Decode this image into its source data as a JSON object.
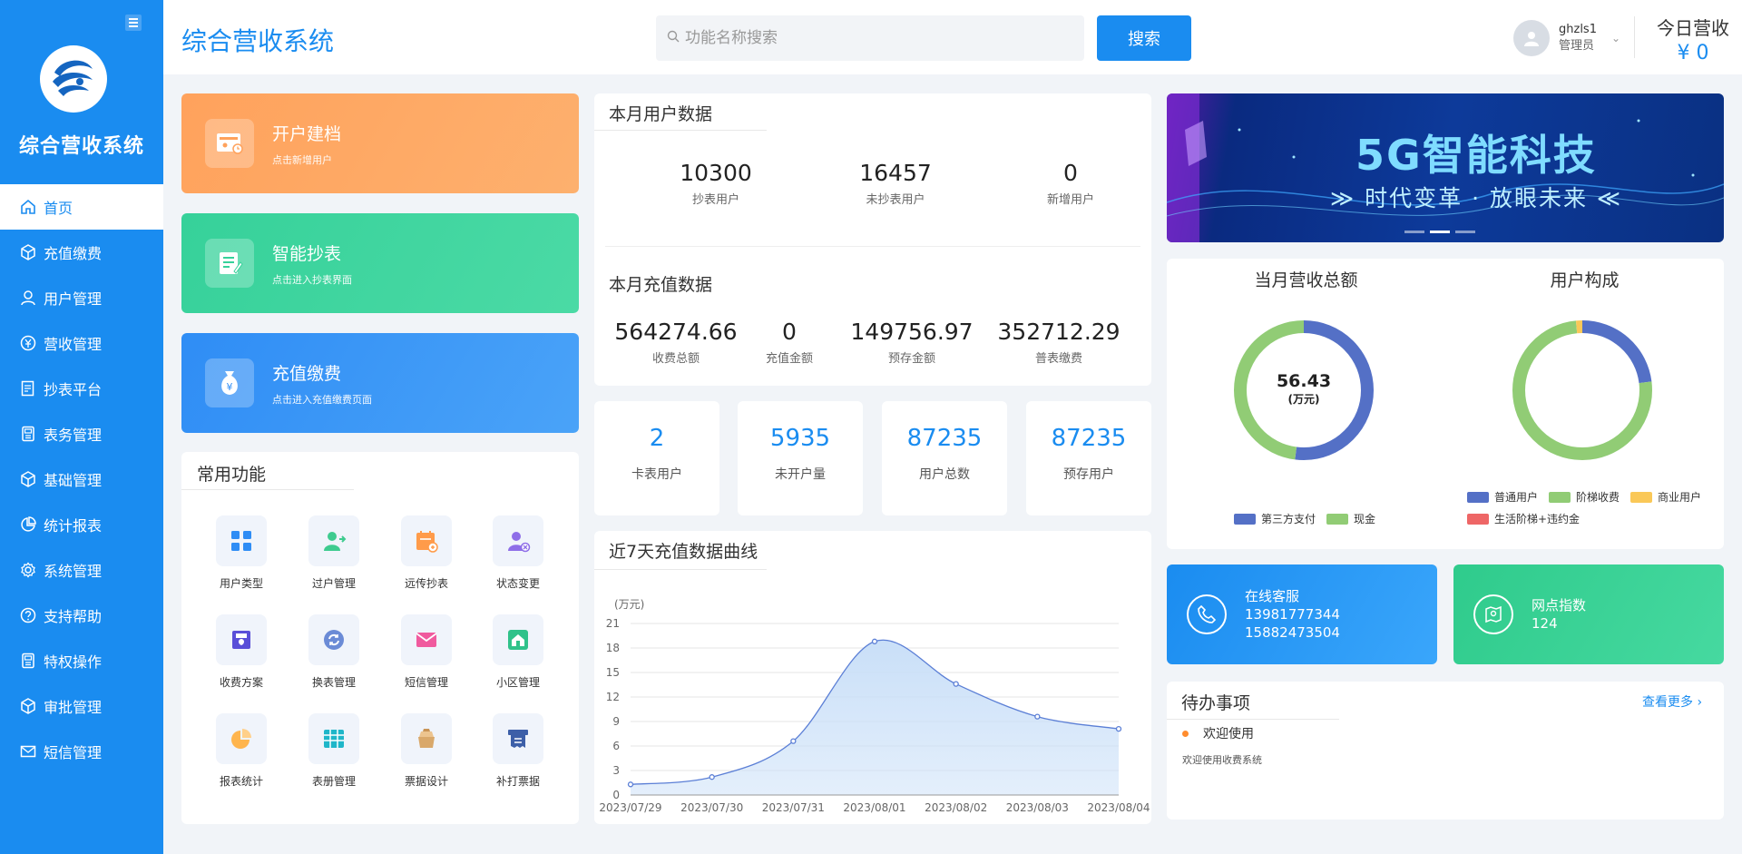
{
  "sidebar": {
    "title": "综合营收系统",
    "items": [
      {
        "label": "首页",
        "icon": "home-icon"
      },
      {
        "label": "充值缴费",
        "icon": "cube-icon"
      },
      {
        "label": "用户管理",
        "icon": "user-icon"
      },
      {
        "label": "营收管理",
        "icon": "yuan-icon"
      },
      {
        "label": "抄表平台",
        "icon": "doc-icon"
      },
      {
        "label": "表务管理",
        "icon": "meter-icon"
      },
      {
        "label": "基础管理",
        "icon": "cube-icon"
      },
      {
        "label": "统计报表",
        "icon": "pie-icon"
      },
      {
        "label": "系统管理",
        "icon": "gear-icon"
      },
      {
        "label": "支持帮助",
        "icon": "help-icon"
      },
      {
        "label": "特权操作",
        "icon": "meter-icon"
      },
      {
        "label": "审批管理",
        "icon": "cube-icon"
      },
      {
        "label": "短信管理",
        "icon": "mail-icon"
      }
    ]
  },
  "header": {
    "title": "综合营收系统",
    "search_placeholder": "功能名称搜索",
    "search_button": "搜索",
    "username": "ghzls1",
    "role": "管理员",
    "today_label": "今日营收",
    "today_value": "¥ 0"
  },
  "actions": [
    {
      "title": "开户建档",
      "sub": "点击新增用户",
      "color_from": "#ffa25c",
      "color_to": "#fdb06e"
    },
    {
      "title": "智能抄表",
      "sub": "点击进入抄表界面",
      "color_from": "#36d19a",
      "color_to": "#4bdaa5"
    },
    {
      "title": "充值缴费",
      "sub": "点击进入充值缴费页面",
      "color_from": "#2f8df5",
      "color_to": "#4aa3f8"
    }
  ],
  "common": {
    "title": "常用功能",
    "items": [
      "用户类型",
      "过户管理",
      "远传抄表",
      "状态变更",
      "收费方案",
      "换表管理",
      "短信管理",
      "小区管理",
      "报表统计",
      "表册管理",
      "票据设计",
      "补打票据"
    ]
  },
  "month_users": {
    "title": "本月用户数据",
    "stats": [
      {
        "value": "10300",
        "label": "抄表用户"
      },
      {
        "value": "16457",
        "label": "未抄表用户"
      },
      {
        "value": "0",
        "label": "新增用户"
      }
    ]
  },
  "month_recharge": {
    "title": "本月充值数据",
    "stats": [
      {
        "value": "564274.66",
        "label": "收费总额"
      },
      {
        "value": "0",
        "label": "充值金额"
      },
      {
        "value": "149756.97",
        "label": "预存金额"
      },
      {
        "value": "352712.29",
        "label": "普表缴费"
      }
    ]
  },
  "mini_stats": [
    {
      "value": "2",
      "label": "卡表用户"
    },
    {
      "value": "5935",
      "label": "未开户量"
    },
    {
      "value": "87235",
      "label": "用户总数"
    },
    {
      "value": "87235",
      "label": "预存用户"
    }
  ],
  "chart_data": {
    "type": "area",
    "title": "近7天充值数据曲线",
    "ylabel": "(万元)",
    "x": [
      "2023/07/29",
      "2023/07/30",
      "2023/07/31",
      "2023/08/01",
      "2023/08/02",
      "2023/08/03",
      "2023/08/04"
    ],
    "values": [
      1.3,
      2.2,
      6.6,
      18.8,
      13.6,
      9.6,
      8.1
    ],
    "ylim": [
      0,
      21
    ],
    "yticks": [
      "0",
      "3",
      "6",
      "9",
      "12",
      "15",
      "18",
      "21"
    ],
    "grid": true,
    "color": "#5b7fd6",
    "fill": "#c9dff8"
  },
  "banner": {
    "title": "5G智能科技",
    "subtitle": "≫ 时代变革 · 放眼未来 ≪"
  },
  "revenue_donut": {
    "title": "当月营收总额",
    "center_value": "56.43",
    "center_unit": "(万元)",
    "slices": [
      {
        "name": "第三方支付",
        "value": 52,
        "color": "#5470c6"
      },
      {
        "name": "现金",
        "value": 48,
        "color": "#91cc75"
      }
    ]
  },
  "user_donut": {
    "title": "用户构成",
    "slices": [
      {
        "name": "普通用户",
        "value": 23,
        "color": "#5470c6"
      },
      {
        "name": "阶梯收费",
        "value": 75.5,
        "color": "#91cc75"
      },
      {
        "name": "商业用户",
        "value": 1.5,
        "color": "#fac858"
      },
      {
        "name": "生活阶梯+违约金",
        "value": 0,
        "color": "#ee6666"
      }
    ]
  },
  "contact": {
    "title": "在线客服",
    "phone1": "13981777344",
    "phone2": "15882473504"
  },
  "network": {
    "title": "网点指数",
    "value": "124"
  },
  "todo": {
    "title": "待办事项",
    "more": "查看更多",
    "item_title": "欢迎使用",
    "item_desc": "欢迎使用收费系统"
  }
}
